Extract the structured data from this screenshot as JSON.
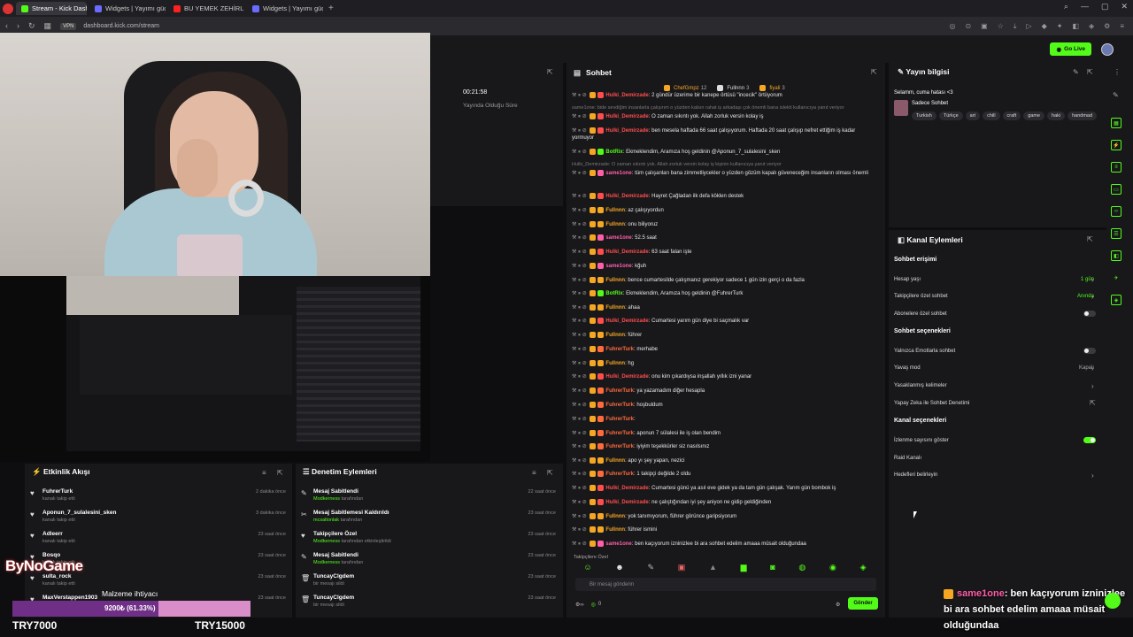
{
  "browser": {
    "tabs": [
      {
        "label": "Stream - Kick Dashboard",
        "active": true,
        "color": "#53fc18"
      },
      {
        "label": "Widgets | Yayımı güçlen",
        "active": false,
        "color": "#6b6bff"
      },
      {
        "label": "BU YEMEK ZEHİRLERİ EFE",
        "active": false,
        "color": "#ff2020"
      },
      {
        "label": "Widgets | Yayımı güçlen",
        "active": false,
        "color": "#6b6bff"
      }
    ],
    "vpn": "VPN",
    "url": "dashboard.kick.com/stream"
  },
  "topbar": {
    "go_live": "Go Live"
  },
  "stream_info": {
    "uptime": "00:21:58",
    "uptime_label": "Yayında Olduğu Süre"
  },
  "chat": {
    "title": "Sohbet",
    "pinned": [
      {
        "name": "ChefGmpz",
        "count": "12",
        "color": "#f5a623"
      },
      {
        "name": "Fullnnn",
        "count": "3",
        "color": "#dddddd"
      },
      {
        "name": "fiyali",
        "count": "3",
        "color": "#f5a623"
      }
    ],
    "messages": [
      {
        "user": "Hulki_Demirzade",
        "color": "#ff4d4d",
        "text": ": 2 gündür üzerime bir kanepe örtüsü \"incecik\" örtüyorum"
      },
      {
        "user": "",
        "color": "#777777",
        "text": "same1one: bide sevdiğim insanlarla çalışırım o yüzden kalsın rahat iş arkadaşı çok önemli bana islekti kullanıcıya yanıt veriyor",
        "sys": true
      },
      {
        "user": "Hulki_Demirzade",
        "color": "#ff4d4d",
        "text": ": O zaman sıkıntı yok. Allah zorluk versin kolay iş"
      },
      {
        "user": "Hulki_Demirzade",
        "color": "#ff4d4d",
        "text": ": ben mesela haftada 66 saat çalışıyorum. Haftada 20 saat çalışıp nefret ettiğim iş kadar yormuyor"
      },
      {
        "user": "BotRix",
        "color": "#53fc18",
        "text": ": Ekmeklendim, Aramıza hoş geldinin @Aponun_7_sulalesini_sken"
      },
      {
        "user": "",
        "color": "#777777",
        "text": "Hulki_Demirzade: O zaman sıkıntı yok. Allah zorluk versin kolay iş kişinin kullanıcıya yanıt veriyor",
        "sys": true
      },
      {
        "user": "same1one",
        "color": "#ff5ea8",
        "text": ": tüm çalışanları bana zimmetliycekler o yüzden gözüm kapalı güveneceğim insanların olması önemli"
      },
      {
        "user": "Hulki_Demirzade",
        "color": "#ff4d4d",
        "text": ": Hayret Çağladan ilk defa köklen destek"
      },
      {
        "user": "Fullnnn",
        "color": "#f5a623",
        "text": ": az çalışıyordun"
      },
      {
        "user": "Fullnnn",
        "color": "#f5a623",
        "text": ": onu biliyoruz"
      },
      {
        "user": "same1one",
        "color": "#ff5ea8",
        "text": ": 52.5 saat"
      },
      {
        "user": "Hulki_Demirzade",
        "color": "#ff4d4d",
        "text": ": 63 saat falan işte"
      },
      {
        "user": "same1one",
        "color": "#ff5ea8",
        "text": ": kğuh"
      },
      {
        "user": "Fullnnn",
        "color": "#f5a623",
        "text": ": bence cumartesilde çalışmanız gerekiyor sadece 1 gün izin gerçi o da fazla"
      },
      {
        "user": "BotRix",
        "color": "#53fc18",
        "text": ": Ekmeklendim, Aramıza hoş geldinin @FuhrerTurk"
      },
      {
        "user": "Fullnnn",
        "color": "#f5a623",
        "text": ": ahaa"
      },
      {
        "user": "Hulki_Demirzade",
        "color": "#ff4d4d",
        "text": ": Cumartesi yarım gün diye bi saçmalık var"
      },
      {
        "user": "Fullnnn",
        "color": "#f5a623",
        "text": ": führer"
      },
      {
        "user": "FuhrerTurk",
        "color": "#ff6a3d",
        "text": ": merhabe"
      },
      {
        "user": "Fullnnn",
        "color": "#f5a623",
        "text": ": hg"
      },
      {
        "user": "Hulki_Demirzade",
        "color": "#ff4d4d",
        "text": ": onu kim çıkardıysa inşallah yıllık izni yanar"
      },
      {
        "user": "FuhrerTurk",
        "color": "#ff6a3d",
        "text": ": ya yazamadım diğer hesapla"
      },
      {
        "user": "FuhrerTurk",
        "color": "#ff6a3d",
        "text": ": hoşbuldum"
      },
      {
        "user": "FuhrerTurk",
        "color": "#ff6a3d",
        "text": ":"
      },
      {
        "user": "FuhrerTurk",
        "color": "#ff6a3d",
        "text": ": aponun 7 sülalesi ile iş olan bendim"
      },
      {
        "user": "FuhrerTurk",
        "color": "#ff6a3d",
        "text": ": iyiyim teşekkürler siz nasılsınız"
      },
      {
        "user": "Fullnnn",
        "color": "#f5a623",
        "text": ": apo yı şey yapan, nezici"
      },
      {
        "user": "FuhrerTurk",
        "color": "#ff6a3d",
        "text": ": 1 takipçi değilde 2 oldu"
      },
      {
        "user": "Hulki_Demirzade",
        "color": "#ff4d4d",
        "text": ": Cumartesi günü ya asıl eve gidek ya da tam gün çalışak. Yarım gün bombok iş"
      },
      {
        "user": "Hulki_Demirzade",
        "color": "#ff4d4d",
        "text": ": ne çalıştığından iyi şey aniyon ne gidip geldiğinden"
      },
      {
        "user": "Fullnnn",
        "color": "#f5a623",
        "text": ": yok tanımıyorum, führer görünce garipsiyorum"
      },
      {
        "user": "Fullnnn",
        "color": "#f5a623",
        "text": ": führer ismini"
      },
      {
        "user": "same1one",
        "color": "#ff5ea8",
        "text": ": ben kaçıyorum izninizlee bi ara sohbet edelim amaaa müsait olduğundaa"
      }
    ],
    "follow_mode": "Takipçilere Özel",
    "input_placeholder": "Bir mesaj gönderin",
    "footer_count": "0",
    "send_label": "Gönder"
  },
  "channel_info": {
    "title": "Yayın bilgisi",
    "stream_title": "Selamm, cuma hatası <3",
    "category": "Sadece Sohbet",
    "tags": [
      "Turkish",
      "Türkçe",
      "art",
      "chill",
      "craft",
      "game",
      "haki",
      "handmad"
    ]
  },
  "channel_actions": {
    "title": "Kanal Eylemleri",
    "chat_access": {
      "heading": "Sohbet erişimi",
      "rows": [
        {
          "label": "Hesap yaşı",
          "value": "1 gün",
          "value_color": "#53fc18"
        },
        {
          "label": "Takipçilere özel sohbet",
          "value": "Anında",
          "value_color": "#53fc18"
        },
        {
          "label": "Abonelere özel sohbet",
          "value": ""
        }
      ]
    },
    "chat_options": {
      "heading": "Sohbet seçenekleri",
      "rows": [
        {
          "label": "Yalnızca Emotlarla sohbet",
          "value": ""
        },
        {
          "label": "Yavaş mod",
          "value": "Kapalı"
        },
        {
          "label": "Yasaklanmış kelimeler",
          "value": ""
        },
        {
          "label": "Yapay Zeka ile Sohbet Denetimi",
          "value": ""
        }
      ]
    },
    "channel_options": {
      "heading": "Kanal seçenekleri",
      "rows": [
        {
          "label": "İzlenme sayısını göster",
          "value": ""
        },
        {
          "label": "Raid Kanalı",
          "value": ""
        },
        {
          "label": "Hedefleri belirleyin",
          "value": ""
        }
      ]
    }
  },
  "activity": {
    "title": "Etkinlik Akışı",
    "items": [
      {
        "name": "FuhrerTurk",
        "sub": "kanalı takip etti",
        "time": "2 dakika önce"
      },
      {
        "name": "Aponun_7_sulalesini_sken",
        "sub": "kanalı takip etti",
        "time": "3 dakika önce"
      },
      {
        "name": "Adleerr",
        "sub": "kanalı takip etti",
        "time": "23 saat önce"
      },
      {
        "name": "Bosqo",
        "sub": "kanalı takip etti",
        "time": "23 saat önce"
      },
      {
        "name": "sulta_rock",
        "sub": "kanalı takip etti",
        "time": "23 saat önce"
      },
      {
        "name": "MaxVerstappen1903",
        "sub": "kanalı takip etti",
        "time": "23 saat önce"
      }
    ]
  },
  "moderation": {
    "title": "Denetim Eylemleri",
    "items": [
      {
        "name": "Mesaj Sabitlendi",
        "sub_user": "Modkerness",
        "sub": "tarafından",
        "time": "22 saat önce",
        "icon": "pin-icon"
      },
      {
        "name": "Mesaj Sabitlemesi Kaldırıldı",
        "sub_user": "mcsaltonlak",
        "sub": "tarafından",
        "time": "23 saat önce",
        "icon": "unpin-icon"
      },
      {
        "name": "Takipçilere Özel",
        "sub_user": "Modkerness",
        "sub": "tarafından etkinleştirildi",
        "time": "23 saat önce",
        "icon": "heart-icon"
      },
      {
        "name": "Mesaj Sabitlendi",
        "sub_user": "Modkerness",
        "sub": "tarafından",
        "time": "23 saat önce",
        "icon": "pin-icon"
      },
      {
        "name": "TuncayClgdem",
        "sub_user": "",
        "sub": "bir mesajı sildi",
        "time": "23 saat önce",
        "icon": "trash-icon"
      },
      {
        "name": "TuncayClgdem",
        "sub_user": "",
        "sub": "bir mesajı sildi",
        "time": "23 saat önce",
        "icon": "trash-icon"
      }
    ]
  },
  "overlay": {
    "logo": "ByNoGame",
    "goal_label": "Malzeme ihtiyacı",
    "goal_text": "9200₺ (61.33%)",
    "goal_progress": 0.6133,
    "goal_min": "TRY7000",
    "goal_max": "TRY15000",
    "chat_user": "same1one",
    "chat_text": ": ben kaçıyorum izninizlee bi ara sohbet edelim amaaa müsait olduğundaa"
  },
  "colors": {
    "accent": "#53fc18",
    "panel": "#18181b",
    "bg": "#0e0e10"
  }
}
